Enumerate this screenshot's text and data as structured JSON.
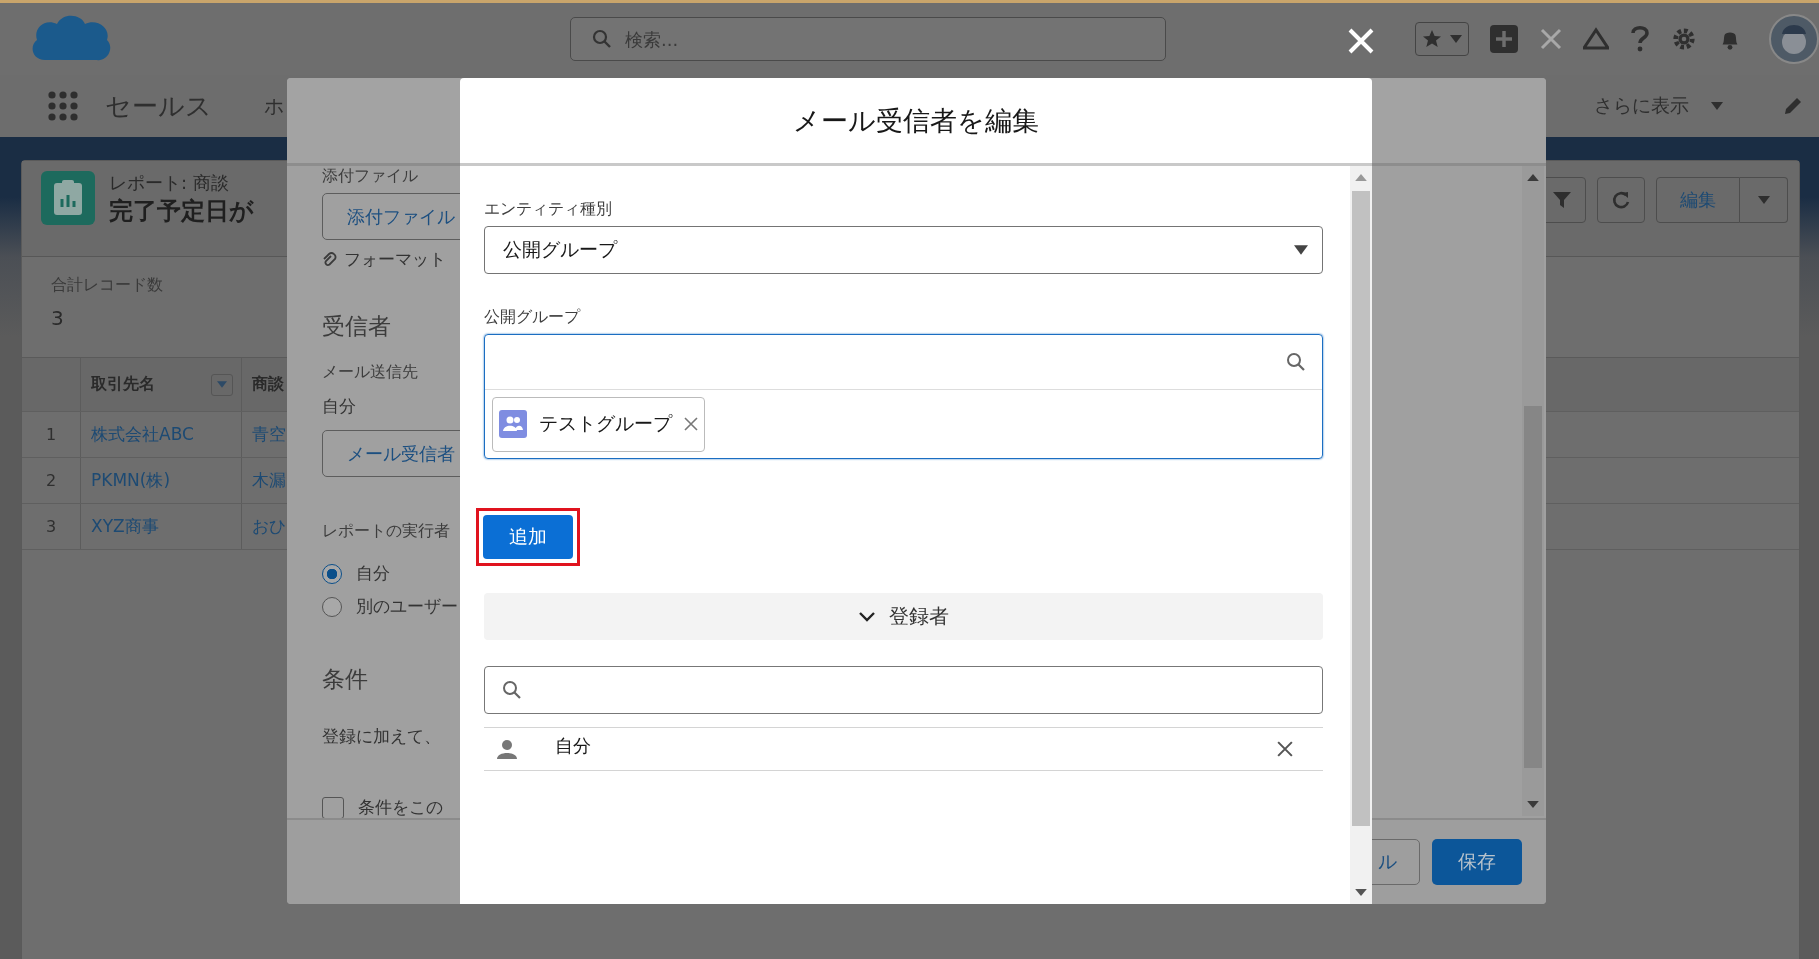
{
  "header": {
    "search": {
      "placeholder": "検索..."
    }
  },
  "nav": {
    "app_name": "セールス",
    "items": [
      {
        "label": "ホ"
      }
    ],
    "more": "さらに表示"
  },
  "report": {
    "type_label": "レポート: 商談",
    "title": "完了予定日が",
    "record_count_label": "合計レコード数",
    "record_count": "3",
    "edit_button": "編集"
  },
  "table": {
    "columns": [
      {
        "label": "取引先名",
        "sortable": true
      },
      {
        "label": "商談",
        "sortable": false
      }
    ],
    "rows": [
      {
        "number": "1",
        "cells": [
          "株式会社ABC",
          "青空"
        ]
      },
      {
        "number": "2",
        "cells": [
          "PKMN(株)",
          "木漏"
        ]
      },
      {
        "number": "3",
        "cells": [
          "XYZ商事",
          "おひ"
        ]
      }
    ]
  },
  "schedule_dialog": {
    "attachment_label": "添付ファイル",
    "attachment_button": "添付ファイル",
    "format_link": "フォーマット",
    "recipients_heading": "受信者",
    "send_to_label": "メール送信先",
    "send_to_value": "自分",
    "edit_recipients_button": "メール受信者",
    "run_as_label": "レポートの実行者",
    "run_as_options": [
      {
        "label": "自分",
        "selected": true
      },
      {
        "label": "別のユーザー",
        "selected": false
      }
    ],
    "conditions_heading": "条件",
    "conditions_text": "登録に加えて、",
    "conditions_checkbox": {
      "label": "条件をこの",
      "checked": false
    },
    "footer_buttons": [
      {
        "label": "ル",
        "kind": "neutral"
      },
      {
        "label": "保存",
        "kind": "brand"
      }
    ]
  },
  "recipients_dialog": {
    "title": "メール受信者を編集",
    "entity_type_label": "エンティティ種別",
    "entity_type_value": "公開グループ",
    "group_label": "公開グループ",
    "selected_groups": [
      {
        "label": "テストグループ"
      }
    ],
    "add_button": {
      "label": "追加",
      "highlighted": true
    },
    "members_section": {
      "title": "登録者",
      "expanded": true
    },
    "members": [
      {
        "name": "自分"
      }
    ]
  }
}
